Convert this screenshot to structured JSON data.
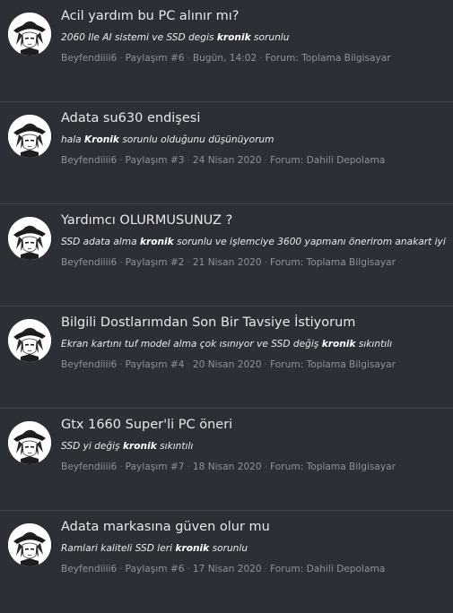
{
  "results": [
    {
      "title": "Acil yardım bu PC alınır mı?",
      "snippet": {
        "before": "2060 Ile AI sistemi ve SSD degis ",
        "highlight": "kronik",
        "after": " sorunlu"
      },
      "author": "Beyfendiiii6",
      "post": "Paylaşım #6",
      "date": "Bugün, 14:02",
      "forum": "Forum: Toplama Bilgisayar"
    },
    {
      "title": "Adata su630 endişesi",
      "snippet": {
        "before": "hala ",
        "highlight": "Kronik",
        "after": " sorunlu olduğunu düşünüyorum"
      },
      "author": "Beyfendiiii6",
      "post": "Paylaşım #3",
      "date": "24 Nisan 2020",
      "forum": "Forum: Dahili Depolama"
    },
    {
      "title": "Yardımcı OLURMUSUNUZ ?",
      "snippet": {
        "before": "SSD adata alma ",
        "highlight": "kronik",
        "after": " sorunlu ve işlemciye 3600 yapmanı önerirom anakart iyi"
      },
      "author": "Beyfendiiii6",
      "post": "Paylaşım #2",
      "date": "21 Nisan 2020",
      "forum": "Forum: Toplama Bilgisayar"
    },
    {
      "title": "Bilgili Dostlarımdan Son Bir Tavsiye İstiyorum",
      "snippet": {
        "before": "Ekran kartını tuf model alma çok ısınıyor ve SSD değiş ",
        "highlight": "kronik",
        "after": " sıkıntılı"
      },
      "author": "Beyfendiiii6",
      "post": "Paylaşım #4",
      "date": "20 Nisan 2020",
      "forum": "Forum: Toplama Bilgisayar"
    },
    {
      "title": "Gtx 1660 Super'li PC öneri",
      "snippet": {
        "before": "SSD yi değiş ",
        "highlight": "kronik",
        "after": " sıkıntılı"
      },
      "author": "Beyfendiiii6",
      "post": "Paylaşım #7",
      "date": "18 Nisan 2020",
      "forum": "Forum: Toplama Bilgisayar"
    },
    {
      "title": "Adata markasına güven olur mu",
      "snippet": {
        "before": "Ramlari kaliteli SSD leri ",
        "highlight": "kronik",
        "after": " sorunlu"
      },
      "author": "Beyfendiiii6",
      "post": "Paylaşım #6",
      "date": "17 Nisan 2020",
      "forum": "Forum: Dahili Depolama"
    }
  ],
  "separator": "·",
  "avatar_icon": "anime-character-avatar-icon",
  "colors": {
    "background": "#2d2f37",
    "divider": "#42454e",
    "title": "#e8e8ea",
    "meta": "#8e929c"
  }
}
